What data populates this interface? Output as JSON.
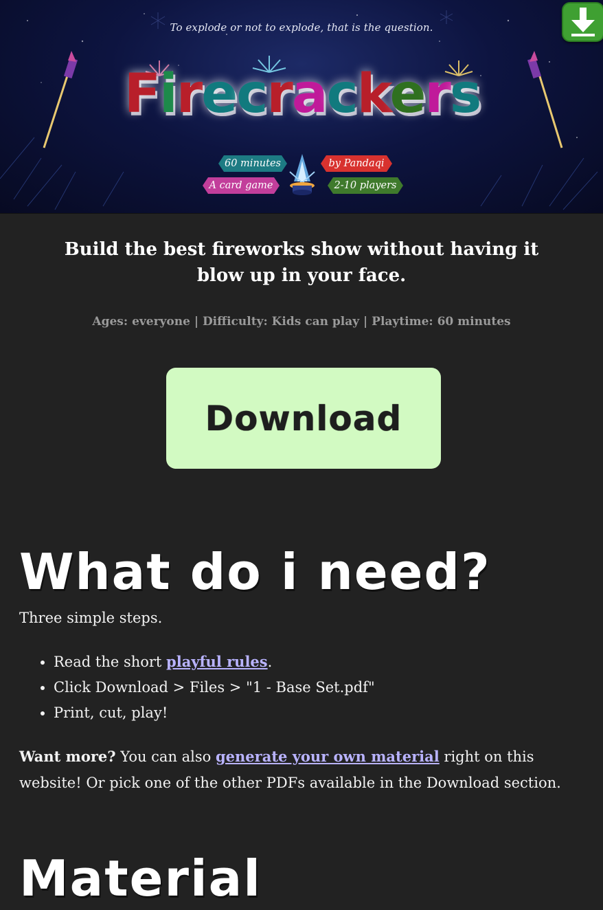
{
  "banner": {
    "tagline": "To explode or not to explode, that is the question.",
    "title_letters": [
      "F",
      "i",
      "r",
      "e",
      "c",
      "r",
      "a",
      "c",
      "k",
      "e",
      "r",
      "s"
    ],
    "tags": {
      "minutes": "60 minutes",
      "author": "by Pandaqi",
      "card": "A card game",
      "players": "2-10 players"
    }
  },
  "corner_button": {
    "icon": "download-arrow-icon"
  },
  "intro": {
    "line1": "Build the best fireworks show without having it",
    "line2": "blow up in your face."
  },
  "meta": "Ages: everyone | Difficulty: Kids can play | Playtime: 60 minutes",
  "download": {
    "label": "Download"
  },
  "need": {
    "heading": "What do i need?",
    "subtitle": "Three simple steps.",
    "steps": {
      "s1_pre": "Read the short ",
      "s1_link": "playful rules",
      "s1_post": ".",
      "s2": "Click Download > Files > \"1 - Base Set.pdf\"",
      "s3": "Print, cut, play!"
    },
    "more_bold": "Want more?",
    "more_pre": " You can also ",
    "more_link": "generate your own material",
    "more_post": " right on this website! Or pick one of the other PDFs available in the Download section."
  },
  "material": {
    "heading": "Material"
  },
  "colors": {
    "background": "#222222",
    "download_button": "#d2fac2",
    "link": "#b9b3ff",
    "meta_text": "#9a9a9a"
  }
}
